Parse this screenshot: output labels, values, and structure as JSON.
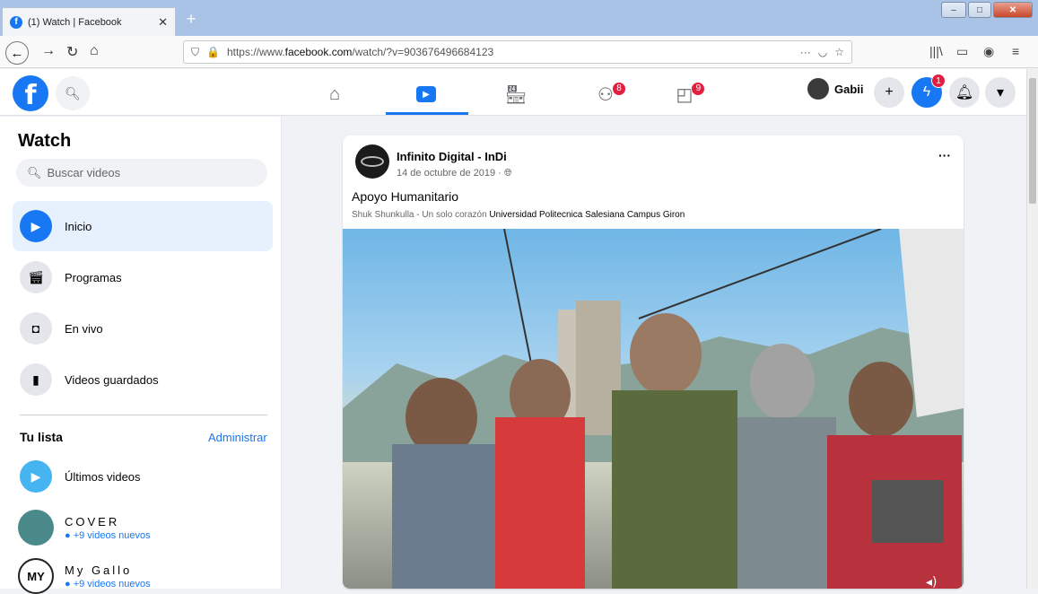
{
  "browser": {
    "tab_title": "(1) Watch | Facebook",
    "tab_close": "✕",
    "new_tab": "+",
    "url_prefix": "https://www.",
    "url_domain": "facebook.com",
    "url_path": "/watch/?v=903676496684123",
    "url_more": "···"
  },
  "header": {
    "logo_letter": "f",
    "badges": {
      "groups": "8",
      "gaming": "9",
      "messenger": "1"
    },
    "profile_name": "Gabii"
  },
  "sidebar": {
    "title": "Watch",
    "search_placeholder": "Buscar videos",
    "items": [
      {
        "label": "Inicio",
        "icon": "watch-play-icon"
      },
      {
        "label": "Programas",
        "icon": "clapper-icon"
      },
      {
        "label": "En vivo",
        "icon": "live-camera-icon"
      },
      {
        "label": "Videos guardados",
        "icon": "bookmark-icon"
      }
    ],
    "list_title": "Tu lista",
    "manage_label": "Administrar",
    "latest_label": "Últimos videos",
    "channels": [
      {
        "name": "COVER",
        "sub": "+9 videos nuevos",
        "color": "#4a8a8a"
      },
      {
        "name": "My Gallo",
        "sub": "+9 videos nuevos",
        "color": "#ffffff"
      }
    ]
  },
  "post": {
    "page_name": "Infinito Digital - InDi",
    "date": "14 de octubre de 2019 · ",
    "title": "Apoyo Humanitario",
    "subtitle_plain": "Shuk Shunkulla - Un solo corazón ",
    "subtitle_link": "Universidad Politecnica Salesiana Campus Giron",
    "more": "···"
  },
  "colors": {
    "brand": "#1877f2",
    "badge": "#e41e3f"
  }
}
